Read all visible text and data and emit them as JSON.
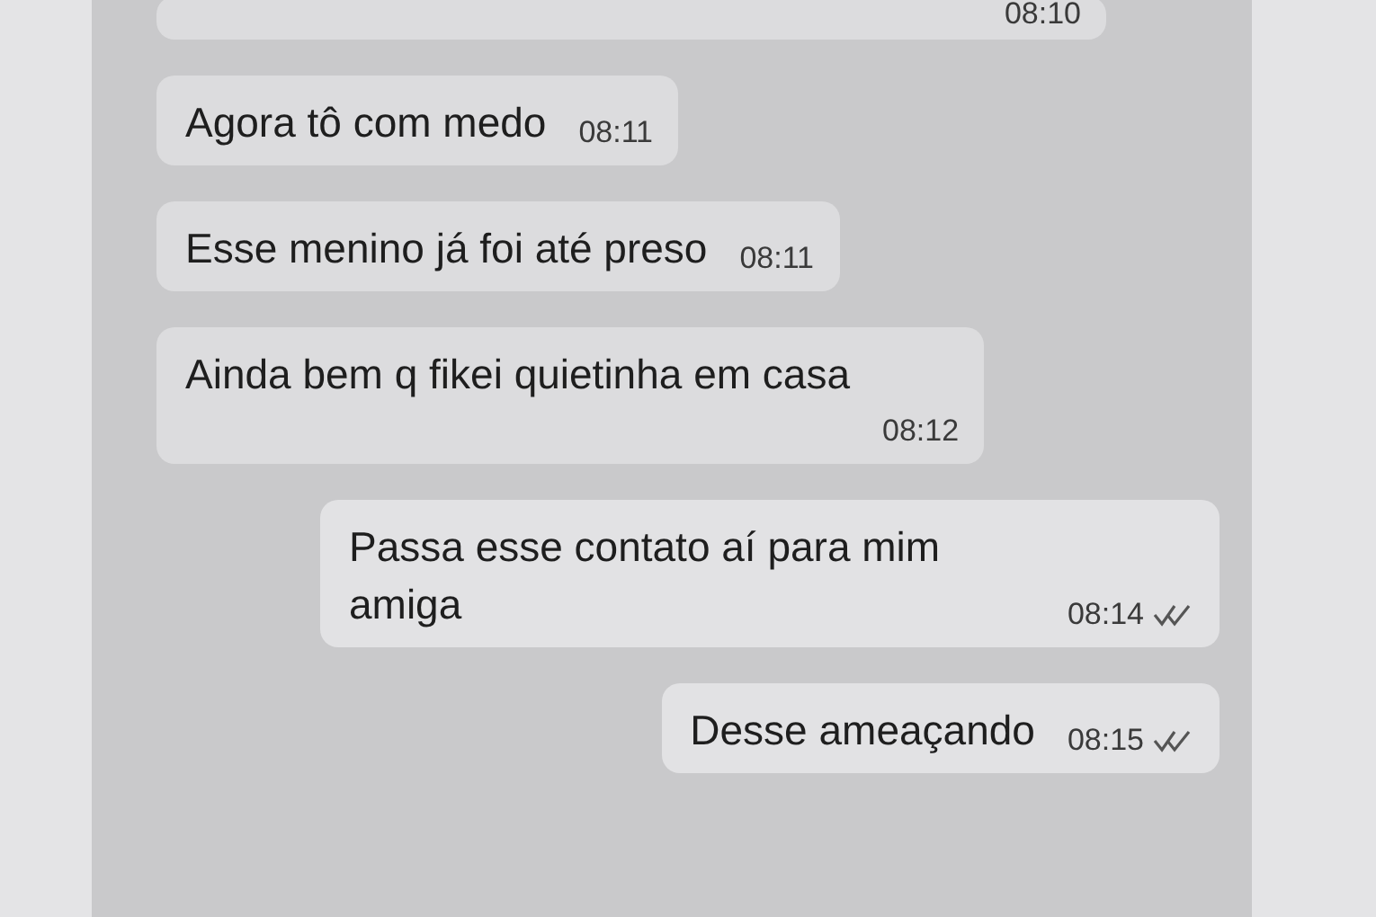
{
  "messages": [
    {
      "kind": "incoming",
      "time": "08:10"
    },
    {
      "kind": "incoming",
      "text": "Agora tô com medo",
      "time": "08:11"
    },
    {
      "kind": "incoming",
      "text": "Esse menino já foi até preso",
      "time": "08:11"
    },
    {
      "kind": "incoming",
      "text": "Ainda bem q fikei quietinha em casa",
      "time": "08:12"
    },
    {
      "kind": "outgoing",
      "text": "Passa esse contato aí para mim amiga",
      "time": "08:14",
      "read": true
    },
    {
      "kind": "outgoing",
      "text": "Desse ameaçando",
      "time": "08:15",
      "read": true
    }
  ]
}
